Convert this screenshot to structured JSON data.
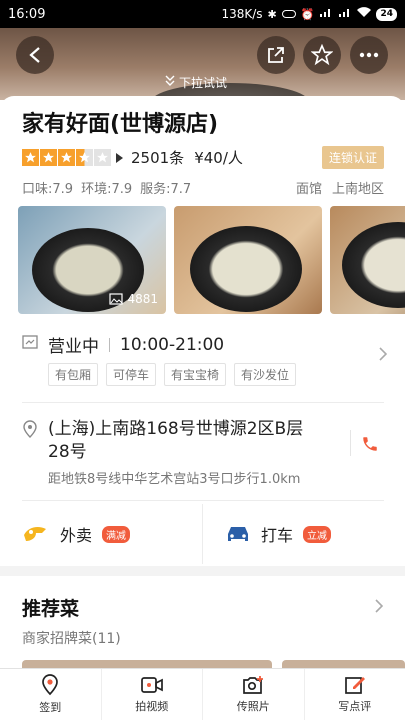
{
  "status_bar": {
    "time": "16:09",
    "net_speed": "138K/s",
    "battery": "24"
  },
  "header": {
    "pull_hint": "下拉试试"
  },
  "shop": {
    "name": "家有好面(世博源店)",
    "review_count": "2501条",
    "price": "¥40/人",
    "chain_badge": "连锁认证",
    "rating_stars": 3.5,
    "scores": [
      "口味:7.9",
      "环境:7.9",
      "服务:7.7"
    ],
    "category": "面馆",
    "district": "上南地区",
    "photo_count": "4881"
  },
  "hours": {
    "status": "营业中",
    "time": "10:00-21:00",
    "tags": [
      "有包厢",
      "可停车",
      "有宝宝椅",
      "有沙发位"
    ]
  },
  "address": {
    "text": "(上海)上南路168号世博源2区B层28号",
    "directions": "距地铁8号线中华艺术宫站3号口步行1.0km"
  },
  "services": [
    {
      "label": "外卖",
      "badge": "满减"
    },
    {
      "label": "打车",
      "badge": "立减"
    }
  ],
  "recommend": {
    "title": "推荐菜",
    "subtitle": "商家招牌菜(11)"
  },
  "tabbar": [
    "签到",
    "拍视频",
    "传照片",
    "写点评"
  ],
  "colors": {
    "star": "#f7a02c",
    "badge_gold": "#e9c68f",
    "accent_red": "#f15c3c",
    "taxi_blue": "#2b5fa8",
    "delivery_yellow": "#f5b51f"
  }
}
